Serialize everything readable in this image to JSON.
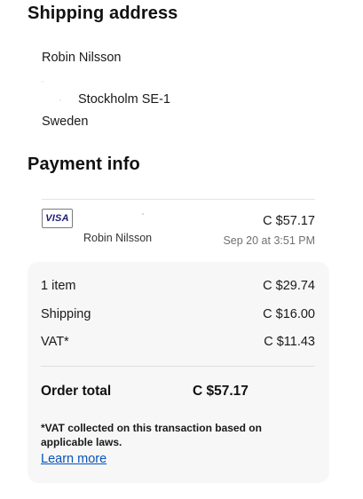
{
  "shipping": {
    "title": "Shipping address",
    "name": "Robin Nilsson",
    "city_line": "Stockholm SE-1",
    "country": "Sweden"
  },
  "payment": {
    "title": "Payment info",
    "card_brand": "VISA",
    "card_holder": "Robin Nilsson",
    "amount": "C $57.17",
    "date": "Sep 20 at 3:51 PM"
  },
  "summary": {
    "rows": [
      {
        "label": "1 item",
        "value": "C $29.74"
      },
      {
        "label": "Shipping",
        "value": "C $16.00"
      },
      {
        "label": "VAT*",
        "value": "C $11.43"
      }
    ],
    "total_label": "Order total",
    "total_value": "C $57.17",
    "vat_note": "*VAT collected on this transaction based on applicable laws.",
    "learn_more": "Learn more"
  },
  "colors": {
    "link": "#0654ba",
    "card_brand": "#1a1f71",
    "summary_bg": "#f7f7f7"
  }
}
